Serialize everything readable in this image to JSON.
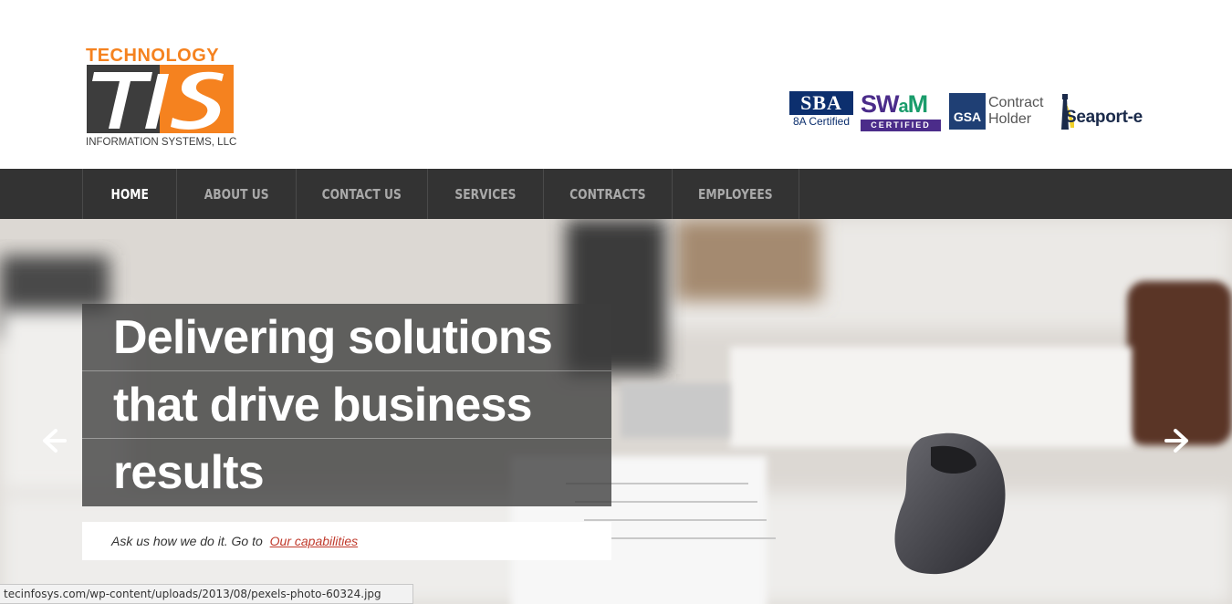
{
  "logo": {
    "top_text": "TECHNOLOGY",
    "mark_text": "TIS",
    "bottom_text": "INFORMATION SYSTEMS, LLC"
  },
  "certifications": {
    "sba": {
      "title": "SBA",
      "subtitle": "8A Certified"
    },
    "swam": {
      "s": "S",
      "w": "W",
      "a": "a",
      "m": "M",
      "subtitle": "CERTIFIED"
    },
    "gsa": {
      "badge": "GSA",
      "line1": "Contract",
      "line2": "Holder"
    },
    "seaport": {
      "text": "Seaport-e"
    }
  },
  "nav": {
    "items": [
      {
        "label": "HOME",
        "active": true
      },
      {
        "label": "ABOUT US",
        "active": false
      },
      {
        "label": "CONTACT US",
        "active": false
      },
      {
        "label": "SERVICES",
        "active": false
      },
      {
        "label": "CONTRACTS",
        "active": false
      },
      {
        "label": "EMPLOYEES",
        "active": false
      }
    ]
  },
  "hero": {
    "headline_lines": [
      "Delivering solutions",
      "that drive business",
      "results"
    ],
    "caption_text": "Ask us how we do it. Go to",
    "caption_link": "Our capabilities",
    "prev_arrow": "arrow-left-icon",
    "next_arrow": "arrow-right-icon"
  },
  "status_bar": {
    "url": "tecinfosys.com/wp-content/uploads/2013/08/pexels-photo-60324.jpg"
  },
  "colors": {
    "brand_orange": "#f5821f",
    "nav_bg": "#333333",
    "link_red": "#c0392b"
  }
}
